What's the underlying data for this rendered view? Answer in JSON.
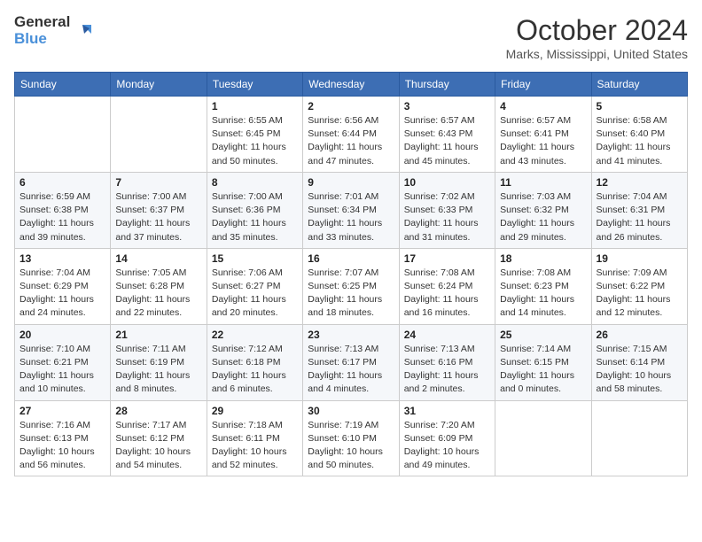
{
  "logo": {
    "general": "General",
    "blue": "Blue"
  },
  "title": "October 2024",
  "location": "Marks, Mississippi, United States",
  "weekdays": [
    "Sunday",
    "Monday",
    "Tuesday",
    "Wednesday",
    "Thursday",
    "Friday",
    "Saturday"
  ],
  "weeks": [
    [
      {
        "day": "",
        "sunrise": "",
        "sunset": "",
        "daylight": ""
      },
      {
        "day": "",
        "sunrise": "",
        "sunset": "",
        "daylight": ""
      },
      {
        "day": "1",
        "sunrise": "Sunrise: 6:55 AM",
        "sunset": "Sunset: 6:45 PM",
        "daylight": "Daylight: 11 hours and 50 minutes."
      },
      {
        "day": "2",
        "sunrise": "Sunrise: 6:56 AM",
        "sunset": "Sunset: 6:44 PM",
        "daylight": "Daylight: 11 hours and 47 minutes."
      },
      {
        "day": "3",
        "sunrise": "Sunrise: 6:57 AM",
        "sunset": "Sunset: 6:43 PM",
        "daylight": "Daylight: 11 hours and 45 minutes."
      },
      {
        "day": "4",
        "sunrise": "Sunrise: 6:57 AM",
        "sunset": "Sunset: 6:41 PM",
        "daylight": "Daylight: 11 hours and 43 minutes."
      },
      {
        "day": "5",
        "sunrise": "Sunrise: 6:58 AM",
        "sunset": "Sunset: 6:40 PM",
        "daylight": "Daylight: 11 hours and 41 minutes."
      }
    ],
    [
      {
        "day": "6",
        "sunrise": "Sunrise: 6:59 AM",
        "sunset": "Sunset: 6:38 PM",
        "daylight": "Daylight: 11 hours and 39 minutes."
      },
      {
        "day": "7",
        "sunrise": "Sunrise: 7:00 AM",
        "sunset": "Sunset: 6:37 PM",
        "daylight": "Daylight: 11 hours and 37 minutes."
      },
      {
        "day": "8",
        "sunrise": "Sunrise: 7:00 AM",
        "sunset": "Sunset: 6:36 PM",
        "daylight": "Daylight: 11 hours and 35 minutes."
      },
      {
        "day": "9",
        "sunrise": "Sunrise: 7:01 AM",
        "sunset": "Sunset: 6:34 PM",
        "daylight": "Daylight: 11 hours and 33 minutes."
      },
      {
        "day": "10",
        "sunrise": "Sunrise: 7:02 AM",
        "sunset": "Sunset: 6:33 PM",
        "daylight": "Daylight: 11 hours and 31 minutes."
      },
      {
        "day": "11",
        "sunrise": "Sunrise: 7:03 AM",
        "sunset": "Sunset: 6:32 PM",
        "daylight": "Daylight: 11 hours and 29 minutes."
      },
      {
        "day": "12",
        "sunrise": "Sunrise: 7:04 AM",
        "sunset": "Sunset: 6:31 PM",
        "daylight": "Daylight: 11 hours and 26 minutes."
      }
    ],
    [
      {
        "day": "13",
        "sunrise": "Sunrise: 7:04 AM",
        "sunset": "Sunset: 6:29 PM",
        "daylight": "Daylight: 11 hours and 24 minutes."
      },
      {
        "day": "14",
        "sunrise": "Sunrise: 7:05 AM",
        "sunset": "Sunset: 6:28 PM",
        "daylight": "Daylight: 11 hours and 22 minutes."
      },
      {
        "day": "15",
        "sunrise": "Sunrise: 7:06 AM",
        "sunset": "Sunset: 6:27 PM",
        "daylight": "Daylight: 11 hours and 20 minutes."
      },
      {
        "day": "16",
        "sunrise": "Sunrise: 7:07 AM",
        "sunset": "Sunset: 6:25 PM",
        "daylight": "Daylight: 11 hours and 18 minutes."
      },
      {
        "day": "17",
        "sunrise": "Sunrise: 7:08 AM",
        "sunset": "Sunset: 6:24 PM",
        "daylight": "Daylight: 11 hours and 16 minutes."
      },
      {
        "day": "18",
        "sunrise": "Sunrise: 7:08 AM",
        "sunset": "Sunset: 6:23 PM",
        "daylight": "Daylight: 11 hours and 14 minutes."
      },
      {
        "day": "19",
        "sunrise": "Sunrise: 7:09 AM",
        "sunset": "Sunset: 6:22 PM",
        "daylight": "Daylight: 11 hours and 12 minutes."
      }
    ],
    [
      {
        "day": "20",
        "sunrise": "Sunrise: 7:10 AM",
        "sunset": "Sunset: 6:21 PM",
        "daylight": "Daylight: 11 hours and 10 minutes."
      },
      {
        "day": "21",
        "sunrise": "Sunrise: 7:11 AM",
        "sunset": "Sunset: 6:19 PM",
        "daylight": "Daylight: 11 hours and 8 minutes."
      },
      {
        "day": "22",
        "sunrise": "Sunrise: 7:12 AM",
        "sunset": "Sunset: 6:18 PM",
        "daylight": "Daylight: 11 hours and 6 minutes."
      },
      {
        "day": "23",
        "sunrise": "Sunrise: 7:13 AM",
        "sunset": "Sunset: 6:17 PM",
        "daylight": "Daylight: 11 hours and 4 minutes."
      },
      {
        "day": "24",
        "sunrise": "Sunrise: 7:13 AM",
        "sunset": "Sunset: 6:16 PM",
        "daylight": "Daylight: 11 hours and 2 minutes."
      },
      {
        "day": "25",
        "sunrise": "Sunrise: 7:14 AM",
        "sunset": "Sunset: 6:15 PM",
        "daylight": "Daylight: 11 hours and 0 minutes."
      },
      {
        "day": "26",
        "sunrise": "Sunrise: 7:15 AM",
        "sunset": "Sunset: 6:14 PM",
        "daylight": "Daylight: 10 hours and 58 minutes."
      }
    ],
    [
      {
        "day": "27",
        "sunrise": "Sunrise: 7:16 AM",
        "sunset": "Sunset: 6:13 PM",
        "daylight": "Daylight: 10 hours and 56 minutes."
      },
      {
        "day": "28",
        "sunrise": "Sunrise: 7:17 AM",
        "sunset": "Sunset: 6:12 PM",
        "daylight": "Daylight: 10 hours and 54 minutes."
      },
      {
        "day": "29",
        "sunrise": "Sunrise: 7:18 AM",
        "sunset": "Sunset: 6:11 PM",
        "daylight": "Daylight: 10 hours and 52 minutes."
      },
      {
        "day": "30",
        "sunrise": "Sunrise: 7:19 AM",
        "sunset": "Sunset: 6:10 PM",
        "daylight": "Daylight: 10 hours and 50 minutes."
      },
      {
        "day": "31",
        "sunrise": "Sunrise: 7:20 AM",
        "sunset": "Sunset: 6:09 PM",
        "daylight": "Daylight: 10 hours and 49 minutes."
      },
      {
        "day": "",
        "sunrise": "",
        "sunset": "",
        "daylight": ""
      },
      {
        "day": "",
        "sunrise": "",
        "sunset": "",
        "daylight": ""
      }
    ]
  ]
}
